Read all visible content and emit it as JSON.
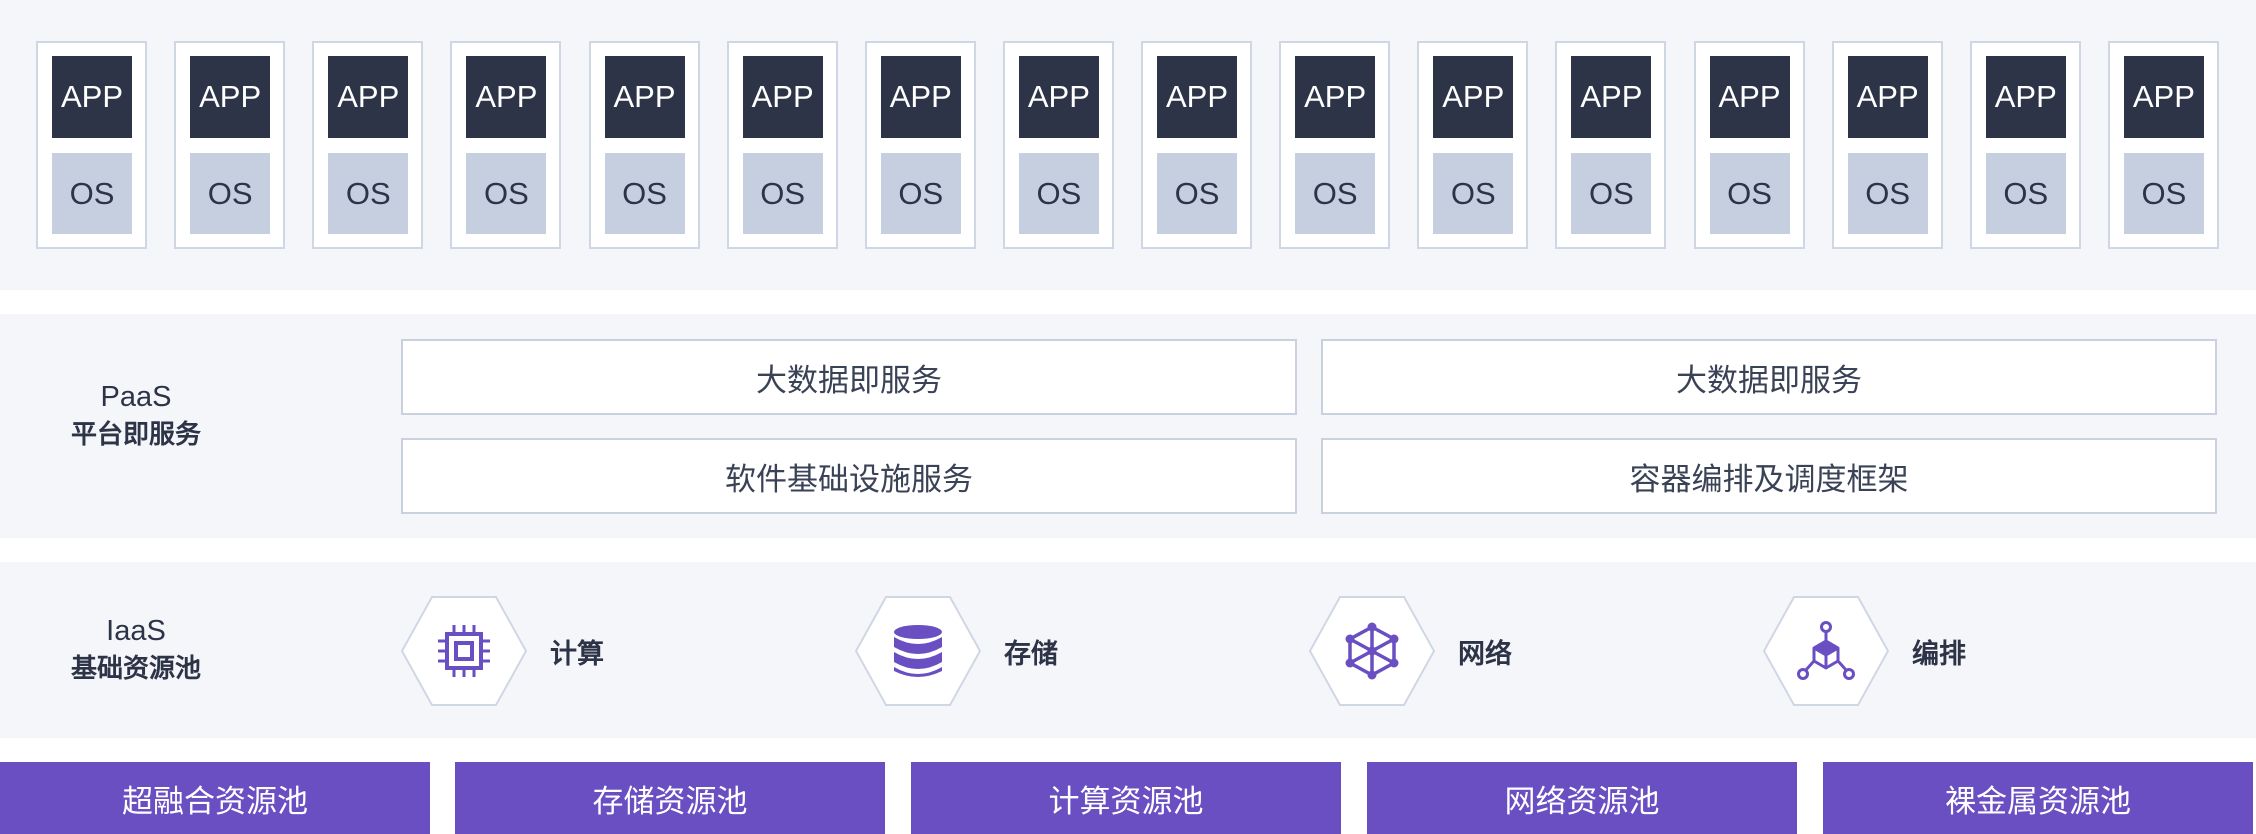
{
  "apps": [
    {
      "app": "APP",
      "os": "OS"
    },
    {
      "app": "APP",
      "os": "OS"
    },
    {
      "app": "APP",
      "os": "OS"
    },
    {
      "app": "APP",
      "os": "OS"
    },
    {
      "app": "APP",
      "os": "OS"
    },
    {
      "app": "APP",
      "os": "OS"
    },
    {
      "app": "APP",
      "os": "OS"
    },
    {
      "app": "APP",
      "os": "OS"
    },
    {
      "app": "APP",
      "os": "OS"
    },
    {
      "app": "APP",
      "os": "OS"
    },
    {
      "app": "APP",
      "os": "OS"
    },
    {
      "app": "APP",
      "os": "OS"
    },
    {
      "app": "APP",
      "os": "OS"
    },
    {
      "app": "APP",
      "os": "OS"
    },
    {
      "app": "APP",
      "os": "OS"
    },
    {
      "app": "APP",
      "os": "OS"
    }
  ],
  "paas": {
    "label_en": "PaaS",
    "label_zh": "平台即服务",
    "services": [
      "大数据即服务",
      "大数据即服务",
      "软件基础设施服务",
      "容器编排及调度框架"
    ]
  },
  "iaas": {
    "label_en": "IaaS",
    "label_zh": "基础资源池",
    "items": [
      {
        "label": "计算",
        "icon": "cpu-chip-icon"
      },
      {
        "label": "存储",
        "icon": "database-icon"
      },
      {
        "label": "网络",
        "icon": "network-cube-icon"
      },
      {
        "label": "编排",
        "icon": "orchestration-icon"
      }
    ]
  },
  "pools": [
    "超融合资源池",
    "存储资源池",
    "计算资源池",
    "网络资源池",
    "裸金属资源池"
  ],
  "colors": {
    "accent": "#6a4fc3",
    "app_box": "#2d3447",
    "os_box": "#c6cfe0",
    "band_bg": "#f4f6fa",
    "border": "#d0d7e4"
  }
}
